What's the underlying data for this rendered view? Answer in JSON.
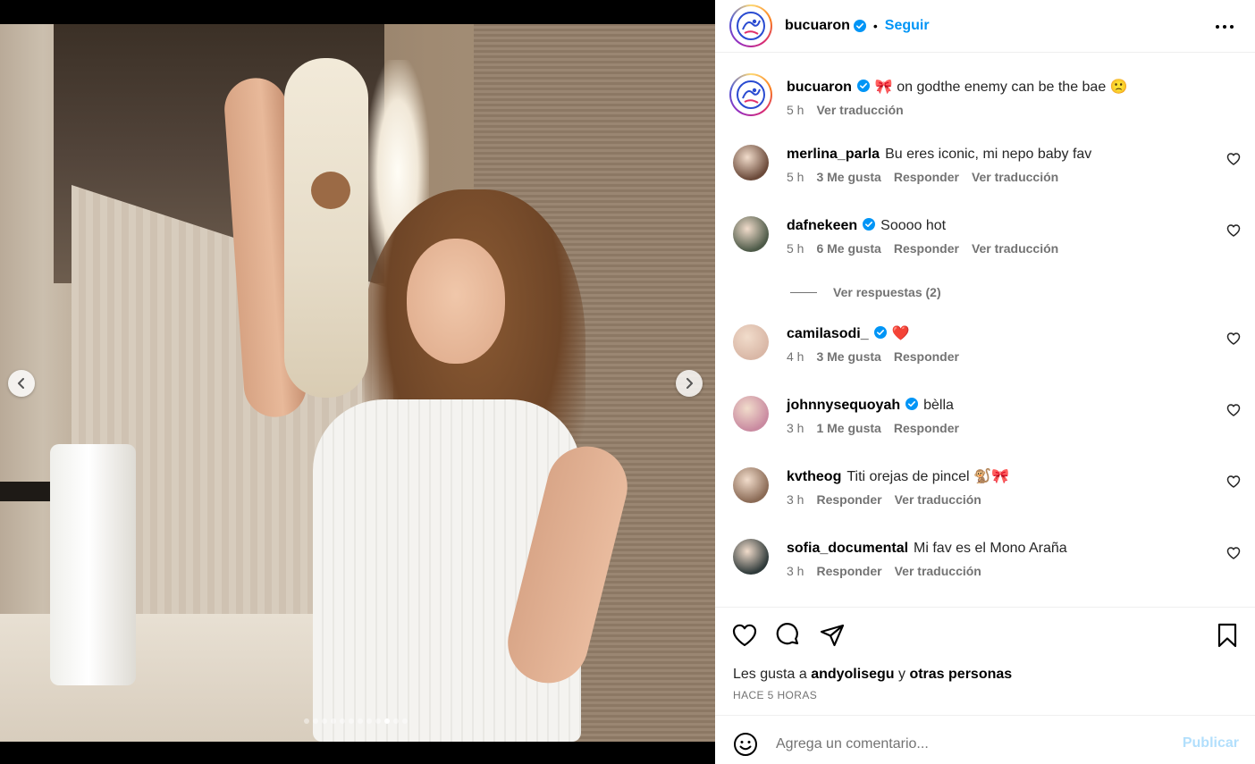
{
  "post": {
    "author": "bucuaron",
    "follow_label": "Seguir",
    "separator": "•"
  },
  "caption": {
    "user": "bucuaron",
    "emoji_before": "🎀",
    "text": "on godthe enemy can be the bae 🙁",
    "time": "5 h",
    "translate": "Ver traducción"
  },
  "comments": [
    {
      "user": "merlina_parla",
      "verified": false,
      "text": "Bu eres iconic, mi nepo baby fav",
      "time": "5 h",
      "likes": "3 Me gusta",
      "reply": "Responder",
      "translate": "Ver traducción",
      "avatar_color": "#6b4a3a"
    },
    {
      "user": "dafnekeen",
      "verified": true,
      "text": "Soooo hot",
      "time": "5 h",
      "likes": "6 Me gusta",
      "reply": "Responder",
      "translate": "Ver traducción",
      "avatar_color": "#4d5a48"
    },
    {
      "user": "camilasodi_",
      "verified": true,
      "text": "❤️",
      "time": "4 h",
      "likes": "3 Me gusta",
      "reply": "Responder",
      "translate": "",
      "avatar_color": "#d9b7a6"
    },
    {
      "user": "johnnysequoyah",
      "verified": true,
      "text": "bèlla",
      "time": "3 h",
      "likes": "1 Me gusta",
      "reply": "Responder",
      "translate": "",
      "avatar_color": "#c98aa0"
    },
    {
      "user": "kvtheog",
      "verified": false,
      "text": "Titi orejas de pincel 🐒🎀",
      "time": "3 h",
      "likes": "",
      "reply": "Responder",
      "translate": "Ver traducción",
      "avatar_color": "#8a6a55"
    },
    {
      "user": "sofia_documental",
      "verified": false,
      "text": "Mi fav es el Mono Araña",
      "time": "3 h",
      "likes": "",
      "reply": "Responder",
      "translate": "Ver traducción",
      "avatar_color": "#2f3a3a"
    }
  ],
  "view_replies": "Ver respuestas (2)",
  "likes": {
    "prefix": "Les gusta a",
    "user": "andyolisegu",
    "conj": "y",
    "others": "otras personas"
  },
  "posted": "HACE 5 HORAS",
  "add_comment": {
    "placeholder": "Agrega un comentario...",
    "publish": "Publicar"
  },
  "carousel": {
    "total": 12,
    "active_index": 9
  },
  "colors": {
    "link_blue": "#0095f6",
    "publish_disabled": "#b2dffc",
    "meta_gray": "#737373",
    "verified_blue": "#0095f6"
  },
  "icons": [
    "chevron-left-icon",
    "chevron-right-icon",
    "more-icon",
    "verified-icon",
    "heart-icon",
    "comment-icon",
    "share-icon",
    "bookmark-icon",
    "emoji-icon"
  ]
}
